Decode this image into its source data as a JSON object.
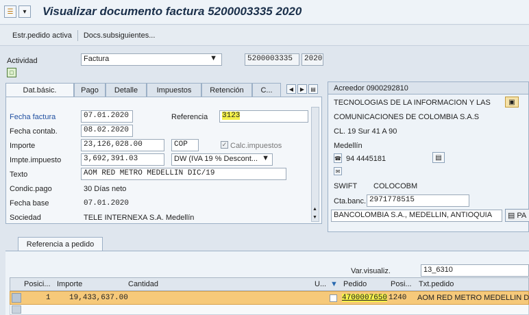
{
  "title": "Visualizar documento factura 5200003335 2020",
  "toolbar": {
    "btn1": "Estr.pedido activa",
    "btn2": "Docs.subsiguientes..."
  },
  "header": {
    "actividad_label": "Actividad",
    "actividad_value": "Factura",
    "doc_number": "5200003335",
    "year": "2020"
  },
  "tabs": [
    "Dat.básic.",
    "Pago",
    "Detalle",
    "Impuestos",
    "Retención",
    "C..."
  ],
  "basic": {
    "fecha_factura_label": "Fecha factura",
    "fecha_factura": "07.01.2020",
    "referencia_label": "Referencia",
    "referencia": "3123",
    "fecha_contab_label": "Fecha contab.",
    "fecha_contab": "08.02.2020",
    "importe_label": "Importe",
    "importe": "23,126,028.00",
    "currency": "COP",
    "calc_label": "Calc.impuestos",
    "impte_label": "Impte.impuesto",
    "impte": "3,692,391.03",
    "tax_code": "DW (IVA 19 % Descont...",
    "texto_label": "Texto",
    "texto": "AOM RED METRO MEDELLIN DIC/19",
    "condic_label": "Condic.pago",
    "condic": "30 Días neto",
    "fecha_base_label": "Fecha base",
    "fecha_base": "07.01.2020",
    "sociedad_label": "Sociedad",
    "sociedad": "TELE INTERNEXA S.A. Medellín"
  },
  "vendor": {
    "title": "Acreedor 0900292810",
    "name1": "TECNOLOGIAS DE LA INFORMACION Y LAS",
    "name2": "COMUNICACIONES DE COLOMBIA S.A.S",
    "street": "CL. 19 Sur 41 A 90",
    "city": "Medellín",
    "phone": "94 4445181",
    "swift_label": "SWIFT",
    "swift": "COLOCOBM",
    "bank_label": "Cta.banc.",
    "bank": "2971778515",
    "bank_name": "BANCOLOMBIA S.A., MEDELLIN, ANTIOQUIA",
    "pa_label": "PA"
  },
  "bottom": {
    "tab_label": "Referencia a pedido",
    "var_label": "Var.visualiz.",
    "var_value": "13_6310",
    "columns": [
      "Posici...",
      "Importe",
      "Cantidad",
      "U...",
      "Pedido",
      "Posi...",
      "Txt.pedido"
    ],
    "row": {
      "pos": "1",
      "importe": "19,433,637.00",
      "pedido": "4700007650",
      "posi": "1240",
      "txt": "AOM RED METRO MEDELLIN DIC"
    }
  }
}
